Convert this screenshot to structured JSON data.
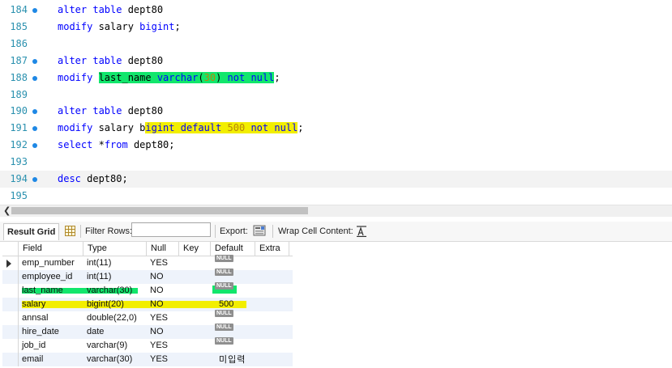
{
  "editor": {
    "lines": [
      {
        "num": "184",
        "tokens": [
          [
            "kw",
            "alter table "
          ],
          [
            "",
            "dept80"
          ]
        ]
      },
      {
        "num": "185",
        "tokens": [
          [
            "kw",
            "modify "
          ],
          [
            "",
            "salary "
          ],
          [
            "kw",
            "bigint"
          ],
          [
            "",
            ";"
          ]
        ]
      },
      {
        "num": "186",
        "tokens": []
      },
      {
        "num": "187",
        "tokens": [
          [
            "kw",
            "alter table "
          ],
          [
            "",
            "dept80"
          ]
        ]
      },
      {
        "num": "188",
        "tokens": [
          [
            "kw",
            "modify "
          ],
          [
            "hlg",
            "last_name "
          ],
          [
            "hlgkw",
            "varchar"
          ],
          [
            "hlg",
            "("
          ],
          [
            "hlgnum",
            "30"
          ],
          [
            "hlg",
            ") "
          ],
          [
            "hlgkw",
            "not null"
          ],
          [
            "",
            ";"
          ]
        ]
      },
      {
        "num": "189",
        "tokens": []
      },
      {
        "num": "190",
        "tokens": [
          [
            "kw",
            "alter table "
          ],
          [
            "",
            "dept80"
          ]
        ]
      },
      {
        "num": "191",
        "tokens": [
          [
            "kw",
            "modify "
          ],
          [
            "",
            "salary b"
          ],
          [
            "hlykw",
            "igint default "
          ],
          [
            "hlynum",
            "500"
          ],
          [
            "hlykw",
            " not null"
          ],
          [
            "",
            ";"
          ]
        ]
      },
      {
        "num": "192",
        "tokens": [
          [
            "kw",
            "select "
          ],
          [
            "",
            "*"
          ],
          [
            "kw",
            "from "
          ],
          [
            "",
            "dept80;"
          ]
        ]
      },
      {
        "num": "193",
        "tokens": []
      },
      {
        "num": "194",
        "tokens": [
          [
            "kw",
            "desc "
          ],
          [
            "",
            "dept80;"
          ]
        ]
      },
      {
        "num": "195",
        "tokens": []
      }
    ]
  },
  "toolbar": {
    "result_tab": "Result Grid",
    "filter_label": "Filter Rows:",
    "filter_value": "",
    "export_label": "Export:",
    "wrap_label": "Wrap Cell Content:"
  },
  "grid": {
    "columns": [
      "Field",
      "Type",
      "Null",
      "Key",
      "Default",
      "Extra"
    ],
    "null_text": "NULL",
    "rows": [
      {
        "field": "emp_number",
        "type": "int(11)",
        "null": "YES",
        "key": "",
        "default": null,
        "extra": ""
      },
      {
        "field": "employee_id",
        "type": "int(11)",
        "null": "NO",
        "key": "",
        "default": null,
        "extra": ""
      },
      {
        "field": "last_name",
        "type": "varchar(30)",
        "null": "NO",
        "key": "",
        "default": null,
        "extra": ""
      },
      {
        "field": "salary",
        "type": "bigint(20)",
        "null": "NO",
        "key": "",
        "default": "500",
        "extra": ""
      },
      {
        "field": "annsal",
        "type": "double(22,0)",
        "null": "YES",
        "key": "",
        "default": null,
        "extra": ""
      },
      {
        "field": "hire_date",
        "type": "date",
        "null": "NO",
        "key": "",
        "default": null,
        "extra": ""
      },
      {
        "field": "job_id",
        "type": "varchar(9)",
        "null": "YES",
        "key": "",
        "default": null,
        "extra": ""
      },
      {
        "field": "email",
        "type": "varchar(30)",
        "null": "YES",
        "key": "",
        "default": "미입력",
        "extra": ""
      }
    ]
  },
  "highlight_colors": {
    "green": "#12e66c",
    "yellow": "#f2ee00"
  },
  "icons": [
    "breakpoint-dot-icon",
    "scroll-left-arrow-icon",
    "grid-view-icon",
    "export-icon",
    "wrap-cell-icon",
    "current-row-arrow-icon"
  ]
}
